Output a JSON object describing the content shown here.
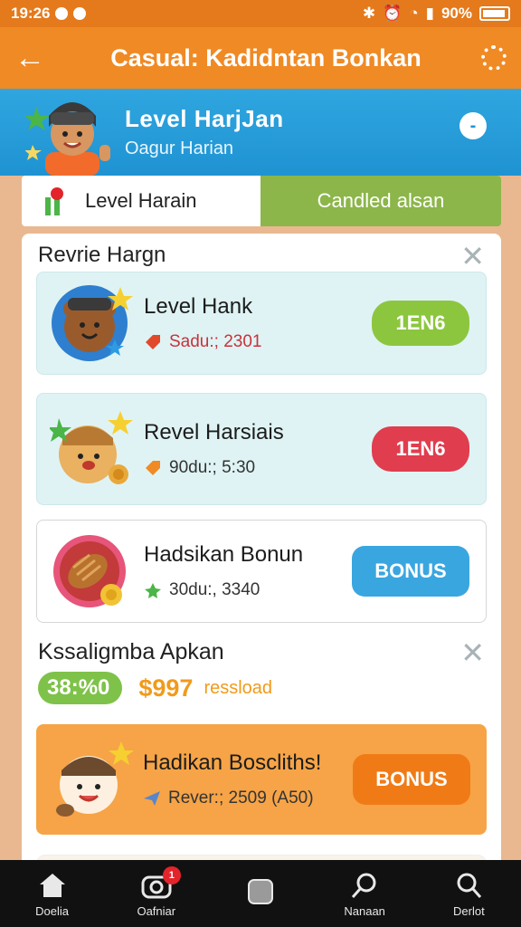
{
  "status_bar": {
    "time": "19:26",
    "battery": "90%"
  },
  "app_bar": {
    "title": "Casual: Kadidntan Bonkan"
  },
  "level_header": {
    "title": "Level HarjJan",
    "subtitle": "Oagur Harian",
    "toggle_symbol": "-"
  },
  "tabs": [
    {
      "label": "Level Harain",
      "active": true
    },
    {
      "label": "Candled alsan",
      "active": false
    }
  ],
  "section1": {
    "title": "Revrie Hargn"
  },
  "cards": [
    {
      "title": "Level Hank",
      "meta": "Sadu:; 2301",
      "button": "1EN6",
      "button_color": "#8cc63f"
    },
    {
      "title": "Revel Harsiais",
      "meta": "90du:; 5:30",
      "button": "1EN6",
      "button_color": "#e03d4e"
    },
    {
      "title": "Hadsikan Bonun",
      "meta": "30du:, 3340",
      "button": "BONUS",
      "button_color": "#3aa6e0"
    }
  ],
  "section2": {
    "title": "Kssaligmba Apkan",
    "stat_pill": "38:%0",
    "money": "$997",
    "note": "ressload"
  },
  "promo_card": {
    "title": "Hadikan Boscliths!",
    "meta": "Rever:; 2509 (A50)",
    "button": "BONUS"
  },
  "bottom_nav": [
    {
      "label": "Doelia",
      "icon": "home-icon"
    },
    {
      "label": "Oafniar",
      "icon": "camera-icon",
      "badge": "1"
    },
    {
      "label": "",
      "icon": "square-icon"
    },
    {
      "label": "Nanaan",
      "icon": "search-icon"
    },
    {
      "label": "Derlot",
      "icon": "magnify-icon"
    }
  ],
  "colors": {
    "orange": "#f08a24",
    "blue": "#1f93d2",
    "green": "#8cc63f",
    "red": "#e03d4e"
  }
}
